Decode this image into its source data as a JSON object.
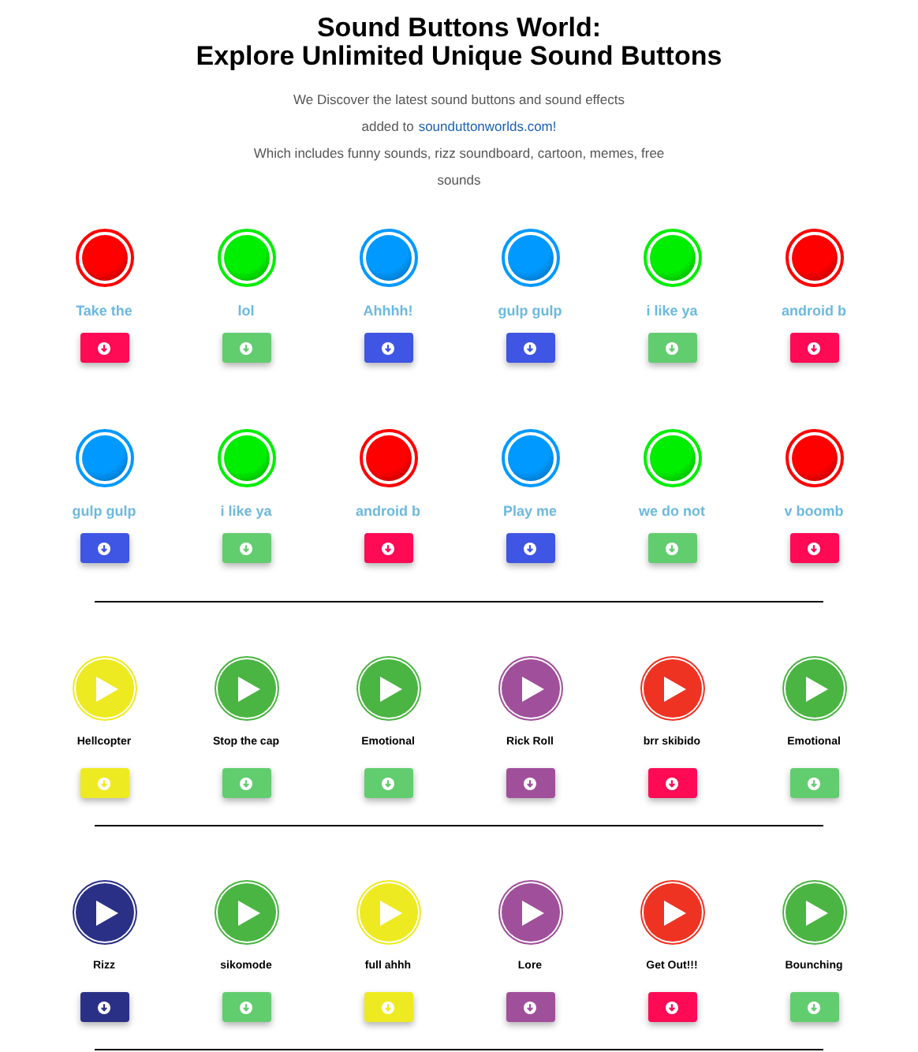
{
  "header": {
    "title_line_1": "Sound Buttons World:",
    "title_line_2": "Explore Unlimited Unique Sound Buttons",
    "intro_1": "We Discover the latest sound buttons and sound effects",
    "intro_2_prefix": "added to",
    "intro_2_link": "sounduttonworlds.com!",
    "intro_3": "Which includes funny sounds, rizz soundboard, cartoon, memes, free sounds"
  },
  "sections": [
    {
      "kind": "glossy",
      "items": [
        {
          "label": "Take the",
          "color": "#ff0000",
          "button": {
            "color": "#ff0a54"
          }
        },
        {
          "label": "lol",
          "color": "#00ee00",
          "button": {
            "color": "#62cd6f"
          }
        },
        {
          "label": "Ahhhh!",
          "color": "#0099ff",
          "button": {
            "color": "#3f55e4"
          }
        },
        {
          "label": "gulp gulp",
          "color": "#0099ff",
          "button": {
            "color": "#3f55e4"
          }
        },
        {
          "label": "i like ya",
          "color": "#00ee00",
          "button": {
            "color": "#62cd6f"
          }
        },
        {
          "label": "android b",
          "color": "#ff0000",
          "button": {
            "color": "#ff0a54"
          }
        },
        {
          "label": "gulp gulp",
          "color": "#0099ff",
          "button": {
            "color": "#3f55e4"
          }
        },
        {
          "label": "i like ya",
          "color": "#00ee00",
          "button": {
            "color": "#62cd6f"
          }
        },
        {
          "label": "android b",
          "color": "#ff0000",
          "button": {
            "color": "#ff0a54"
          }
        },
        {
          "label": "Play me",
          "color": "#0099ff",
          "button": {
            "color": "#3f55e4"
          }
        },
        {
          "label": "we do not",
          "color": "#00ee00",
          "button": {
            "color": "#62cd6f"
          }
        },
        {
          "label": "v boomb",
          "color": "#ff0000",
          "button": {
            "color": "#ff0a54"
          }
        }
      ]
    },
    {
      "kind": "play",
      "items": [
        {
          "label": "Hellcopter",
          "color": "#eeea22",
          "button": {
            "color": "#eeea22"
          }
        },
        {
          "label": "Stop the cap",
          "color": "#4bb543",
          "button": {
            "color": "#62cd6f"
          }
        },
        {
          "label": "Emotional",
          "color": "#4bb543",
          "button": {
            "color": "#62cd6f"
          }
        },
        {
          "label": "Rick Roll",
          "color": "#a04f9b",
          "button": {
            "color": "#a04f9b"
          }
        },
        {
          "label": "brr skibido",
          "color": "#ef3323",
          "button": {
            "color": "#ff0a54"
          }
        },
        {
          "label": "Emotional",
          "color": "#4bb543",
          "button": {
            "color": "#62cd6f"
          }
        }
      ]
    },
    {
      "kind": "play",
      "items": [
        {
          "label": "Rizz",
          "color": "#2b3087",
          "button": {
            "color": "#2b3087"
          }
        },
        {
          "label": "sikomode",
          "color": "#4bb543",
          "button": {
            "color": "#62cd6f"
          }
        },
        {
          "label": "full ahhh",
          "color": "#eeea22",
          "button": {
            "color": "#eeea22"
          }
        },
        {
          "label": "Lore",
          "color": "#a04f9b",
          "button": {
            "color": "#a04f9b"
          }
        },
        {
          "label": "Get Out!!!",
          "color": "#ef3323",
          "button": {
            "color": "#ff0a54"
          }
        },
        {
          "label": "Bounching",
          "color": "#4bb543",
          "button": {
            "color": "#62cd6f"
          }
        }
      ]
    }
  ]
}
